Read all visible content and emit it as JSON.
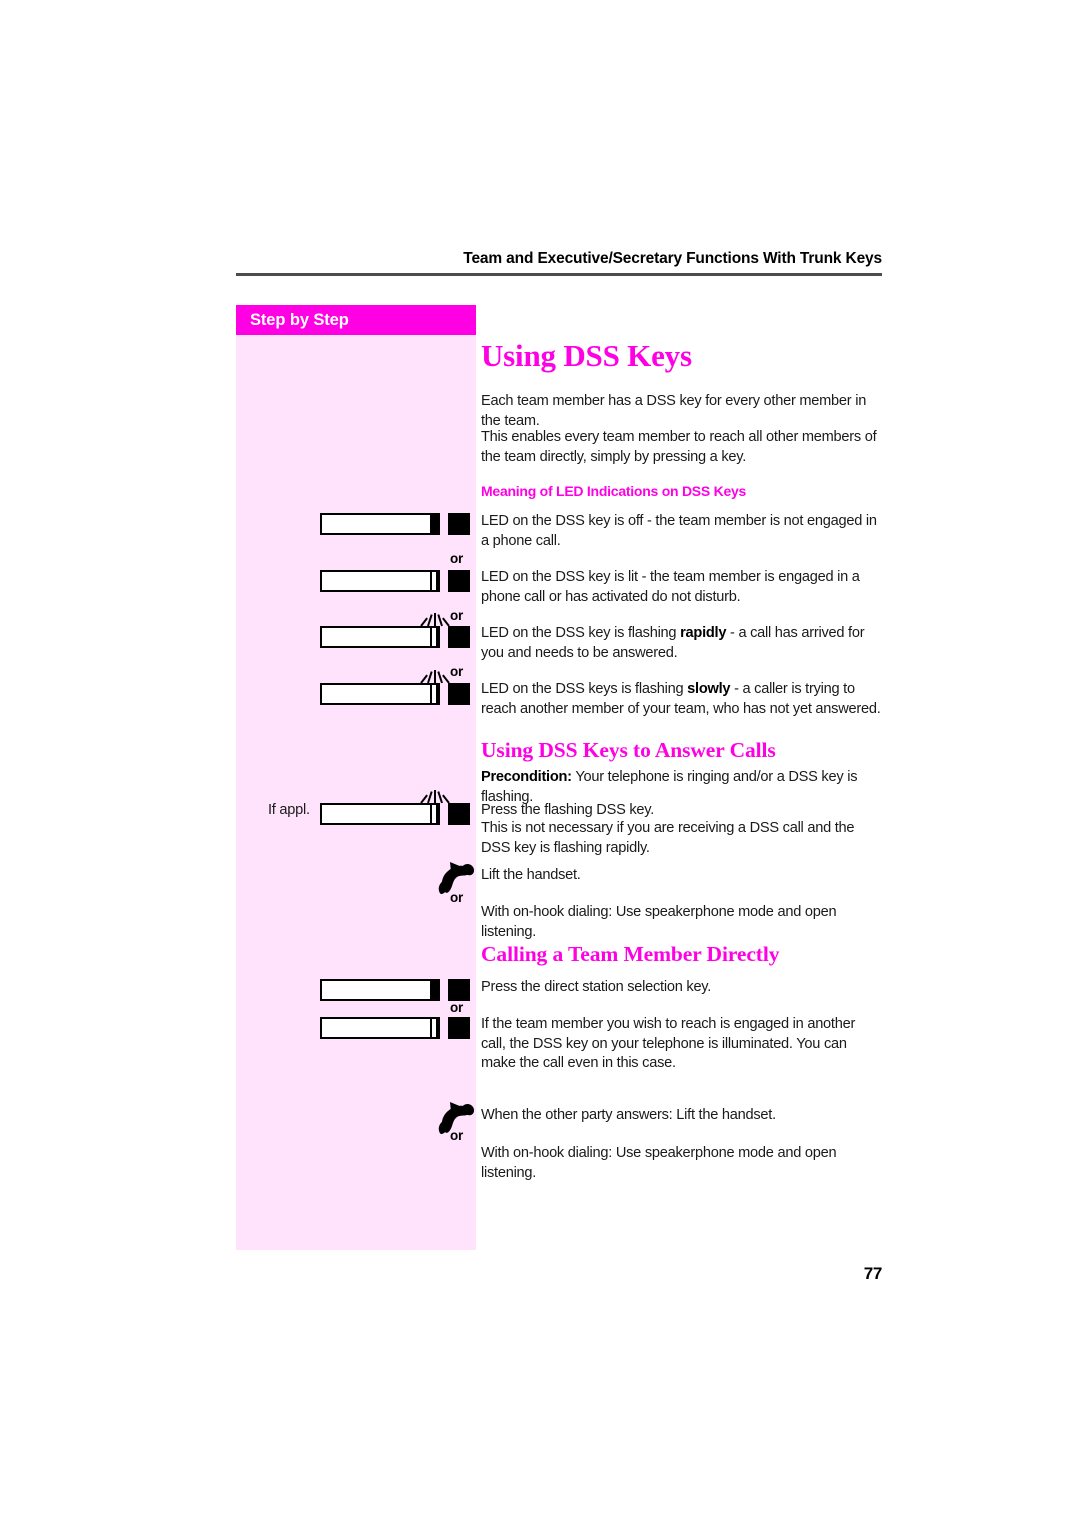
{
  "header": {
    "running_title": "Team and Executive/Secretary Functions With Trunk Keys"
  },
  "sidebar": {
    "header_label": "Step by Step"
  },
  "page_number": "77",
  "colors": {
    "accent_magenta": "#ff00e4",
    "sidebar_fill": "#ffe2fb",
    "rule_gray": "#4d4d4d"
  },
  "sections": [
    {
      "id": "using-dss-keys",
      "title": "Using DSS Keys",
      "intro_paragraphs": [
        "Each team member has a DSS key for every other member in the team.",
        "This enables every team member to reach all other members of the team directly, simply by pressing a key."
      ],
      "led_subheading": "Meaning of LED Indications on DSS Keys",
      "led_rows": [
        {
          "icon": "dss-key-led-off",
          "text_before": "LED on the DSS key is off - the team member is not engaged in a phone call.",
          "emphasis": "",
          "text_after": "",
          "connector": "or"
        },
        {
          "icon": "dss-key-led-lit",
          "text_before": "LED on the DSS key is lit - the team member is engaged in a phone call or has activated do not disturb.",
          "emphasis": "",
          "text_after": "",
          "connector": "or"
        },
        {
          "icon": "dss-key-led-flashing-rapid",
          "text_before": "LED on the DSS key is flashing ",
          "emphasis": "rapidly",
          "text_after": " - a call has arrived for you and needs to be answered.",
          "connector": "or"
        },
        {
          "icon": "dss-key-led-flashing-slow",
          "text_before": "LED on the DSS keys is flashing ",
          "emphasis": "slowly",
          "text_after": " - a caller is trying to reach another member of your team, who has not yet answered.",
          "connector": ""
        }
      ]
    },
    {
      "id": "using-dss-keys-to-answer-calls",
      "title": "Using DSS Keys to Answer Calls",
      "precondition_label": "Precondition:",
      "precondition_text": " Your telephone is ringing and/or a DSS key is flashing.",
      "if_applicable_label": "If appl.",
      "press_flashing_text": "Press the flashing DSS key.",
      "press_flashing_note": "This is not necessary if you are receiving a DSS call and the DSS key is flashing rapidly.",
      "lift_handset_text": "Lift the handset.",
      "or_connector": "or",
      "on_hook_text": "With on-hook dialing: Use speakerphone mode and open listening."
    },
    {
      "id": "calling-a-team-member-directly",
      "title": "Calling a Team Member Directly",
      "press_dss_text": "Press the direct station selection key.",
      "or_connector_1": "or",
      "engaged_text": "If the team member you wish to reach is engaged in another call, the DSS key on your telephone is illuminated. You can make the call even in this case.",
      "answers_text": "When the other party answers: Lift the handset.",
      "or_connector_2": "or",
      "on_hook_text": "With on-hook dialing: Use speakerphone mode and open listening."
    }
  ]
}
